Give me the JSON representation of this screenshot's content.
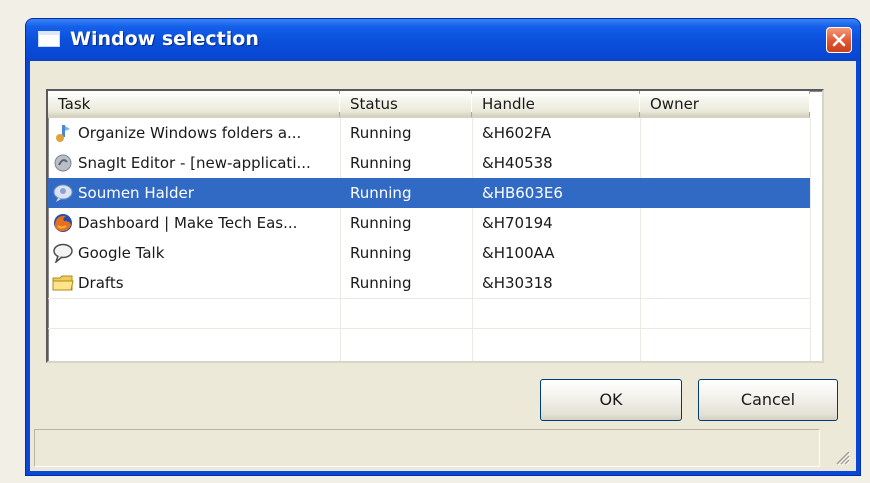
{
  "window": {
    "title": "Window selection",
    "title_icon": "window-icon",
    "close_icon": "close-icon"
  },
  "list": {
    "columns": [
      "Task",
      "Status",
      "Handle",
      "Owner"
    ],
    "rows": [
      {
        "task": "Organize Windows folders a...",
        "status": "Running",
        "handle": "&H602FA",
        "owner": "",
        "icon": "folder-organizer-icon",
        "selected": false
      },
      {
        "task": "SnagIt Editor - [new-applicati...",
        "status": "Running",
        "handle": "&H40538",
        "owner": "",
        "icon": "snagit-icon",
        "selected": false
      },
      {
        "task": "Soumen Halder",
        "status": "Running",
        "handle": "&HB603E6",
        "owner": "",
        "icon": "chat-user-icon",
        "selected": true
      },
      {
        "task": "Dashboard | Make Tech Eas...",
        "status": "Running",
        "handle": "&H70194",
        "owner": "",
        "icon": "firefox-icon",
        "selected": false
      },
      {
        "task": "Google Talk",
        "status": "Running",
        "handle": "&H100AA",
        "owner": "",
        "icon": "google-talk-icon",
        "selected": false
      },
      {
        "task": "Drafts",
        "status": "Running",
        "handle": "&H30318",
        "owner": "",
        "icon": "folder-icon",
        "selected": false
      }
    ]
  },
  "buttons": {
    "ok": "OK",
    "cancel": "Cancel"
  },
  "colors": {
    "selection": "#316ac5",
    "titlebar": "#0a50dc",
    "close": "#e2562e"
  }
}
